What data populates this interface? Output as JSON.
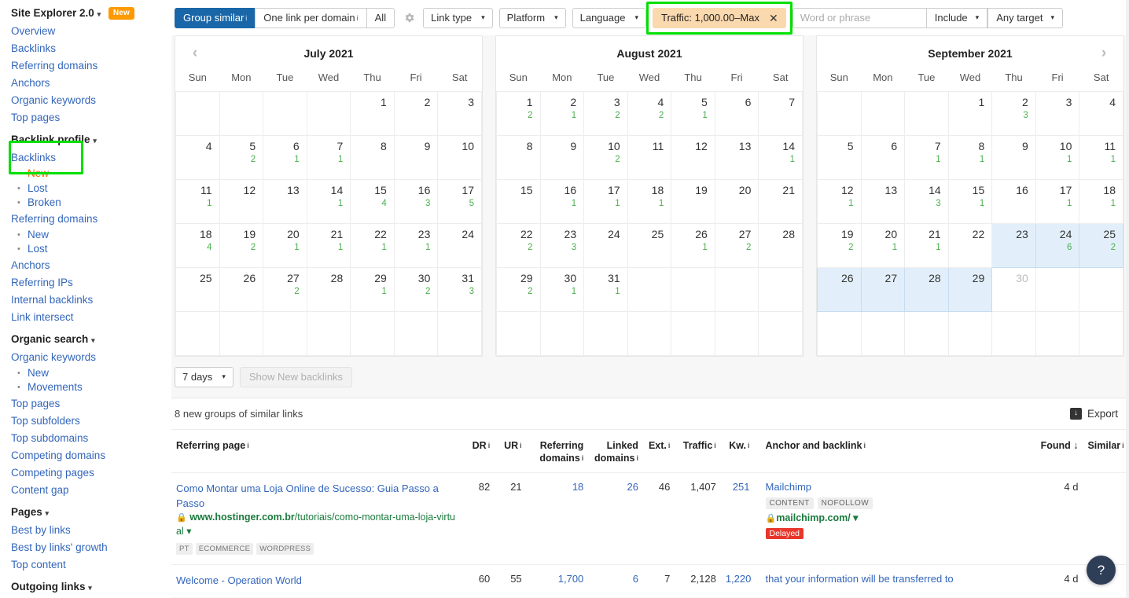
{
  "sidebar": {
    "header": {
      "title": "Site Explorer 2.0",
      "caret": "▾",
      "badge": "New"
    },
    "top_links": [
      "Overview",
      "Backlinks",
      "Referring domains",
      "Anchors",
      "Organic keywords",
      "Top pages"
    ],
    "groups": [
      {
        "title": "Backlink profile",
        "caret": "▾",
        "items": [
          {
            "label": "Backlinks",
            "type": "link"
          },
          {
            "label": "New",
            "type": "sub",
            "active": true
          },
          {
            "label": "Lost",
            "type": "sub"
          },
          {
            "label": "Broken",
            "type": "sub"
          },
          {
            "label": "Referring domains",
            "type": "link"
          },
          {
            "label": "New",
            "type": "sub"
          },
          {
            "label": "Lost",
            "type": "sub"
          },
          {
            "label": "Anchors",
            "type": "link"
          },
          {
            "label": "Referring IPs",
            "type": "link"
          },
          {
            "label": "Internal backlinks",
            "type": "link"
          },
          {
            "label": "Link intersect",
            "type": "link"
          }
        ]
      },
      {
        "title": "Organic search",
        "caret": "▾",
        "items": [
          {
            "label": "Organic keywords",
            "type": "link"
          },
          {
            "label": "New",
            "type": "sub"
          },
          {
            "label": "Movements",
            "type": "sub"
          },
          {
            "label": "Top pages",
            "type": "link"
          },
          {
            "label": "Top subfolders",
            "type": "link"
          },
          {
            "label": "Top subdomains",
            "type": "link"
          },
          {
            "label": "Competing domains",
            "type": "link"
          },
          {
            "label": "Competing pages",
            "type": "link"
          },
          {
            "label": "Content gap",
            "type": "link"
          }
        ]
      },
      {
        "title": "Pages",
        "caret": "▾",
        "items": [
          {
            "label": "Best by links",
            "type": "link"
          },
          {
            "label": "Best by links' growth",
            "type": "link"
          },
          {
            "label": "Top content",
            "type": "link"
          }
        ]
      },
      {
        "title": "Outgoing links",
        "caret": "▾",
        "items": []
      }
    ]
  },
  "toolbar": {
    "group_similar": "Group similar",
    "one_link_per_domain": "One link per domain",
    "all": "All",
    "gear_icon": "gear-icon",
    "link_type": "Link type",
    "platform": "Platform",
    "language": "Language",
    "traffic_filter": "Traffic: 1,000.00–Max",
    "traffic_filter_clear": "✕",
    "search_placeholder": "Word or phrase",
    "search_value": "",
    "include": "Include",
    "any_target": "Any target",
    "caret": "▾"
  },
  "calendars": {
    "weekdays": [
      "Sun",
      "Mon",
      "Tue",
      "Wed",
      "Thu",
      "Fri",
      "Sat"
    ],
    "prev_icon": "‹",
    "next_icon": "›",
    "months": [
      {
        "title": "July 2021",
        "weeks": [
          [
            {},
            {},
            {},
            {},
            {
              "d": "1"
            },
            {
              "d": "2"
            },
            {
              "d": "3"
            }
          ],
          [
            {
              "d": "4"
            },
            {
              "d": "5",
              "c": "2"
            },
            {
              "d": "6",
              "c": "1"
            },
            {
              "d": "7",
              "c": "1"
            },
            {
              "d": "8"
            },
            {
              "d": "9"
            },
            {
              "d": "10"
            }
          ],
          [
            {
              "d": "11",
              "c": "1"
            },
            {
              "d": "12"
            },
            {
              "d": "13"
            },
            {
              "d": "14",
              "c": "1"
            },
            {
              "d": "15",
              "c": "4"
            },
            {
              "d": "16",
              "c": "3"
            },
            {
              "d": "17",
              "c": "5"
            }
          ],
          [
            {
              "d": "18",
              "c": "4"
            },
            {
              "d": "19",
              "c": "2"
            },
            {
              "d": "20",
              "c": "1"
            },
            {
              "d": "21",
              "c": "1"
            },
            {
              "d": "22",
              "c": "1"
            },
            {
              "d": "23",
              "c": "1"
            },
            {
              "d": "24"
            }
          ],
          [
            {
              "d": "25"
            },
            {
              "d": "26"
            },
            {
              "d": "27",
              "c": "2"
            },
            {
              "d": "28"
            },
            {
              "d": "29",
              "c": "1"
            },
            {
              "d": "30",
              "c": "2"
            },
            {
              "d": "31",
              "c": "3"
            }
          ],
          [
            {},
            {},
            {},
            {},
            {},
            {},
            {}
          ]
        ]
      },
      {
        "title": "August 2021",
        "weeks": [
          [
            {
              "d": "1",
              "c": "2"
            },
            {
              "d": "2",
              "c": "1"
            },
            {
              "d": "3",
              "c": "2"
            },
            {
              "d": "4",
              "c": "2"
            },
            {
              "d": "5",
              "c": "1"
            },
            {
              "d": "6"
            },
            {
              "d": "7"
            }
          ],
          [
            {
              "d": "8"
            },
            {
              "d": "9"
            },
            {
              "d": "10",
              "c": "2"
            },
            {
              "d": "11"
            },
            {
              "d": "12"
            },
            {
              "d": "13"
            },
            {
              "d": "14",
              "c": "1"
            }
          ],
          [
            {
              "d": "15"
            },
            {
              "d": "16",
              "c": "1"
            },
            {
              "d": "17",
              "c": "1"
            },
            {
              "d": "18",
              "c": "1"
            },
            {
              "d": "19"
            },
            {
              "d": "20"
            },
            {
              "d": "21"
            }
          ],
          [
            {
              "d": "22",
              "c": "2"
            },
            {
              "d": "23",
              "c": "3"
            },
            {
              "d": "24"
            },
            {
              "d": "25"
            },
            {
              "d": "26",
              "c": "1"
            },
            {
              "d": "27",
              "c": "2"
            },
            {
              "d": "28"
            }
          ],
          [
            {
              "d": "29",
              "c": "2"
            },
            {
              "d": "30",
              "c": "1"
            },
            {
              "d": "31",
              "c": "1"
            },
            {},
            {},
            {},
            {}
          ],
          [
            {},
            {},
            {},
            {},
            {},
            {},
            {}
          ]
        ]
      },
      {
        "title": "September 2021",
        "weeks": [
          [
            {},
            {},
            {},
            {
              "d": "1"
            },
            {
              "d": "2",
              "c": "3"
            },
            {
              "d": "3"
            },
            {
              "d": "4"
            }
          ],
          [
            {
              "d": "5"
            },
            {
              "d": "6"
            },
            {
              "d": "7",
              "c": "1"
            },
            {
              "d": "8",
              "c": "1"
            },
            {
              "d": "9"
            },
            {
              "d": "10",
              "c": "1"
            },
            {
              "d": "11",
              "c": "1"
            }
          ],
          [
            {
              "d": "12",
              "c": "1"
            },
            {
              "d": "13"
            },
            {
              "d": "14",
              "c": "3"
            },
            {
              "d": "15",
              "c": "1"
            },
            {
              "d": "16"
            },
            {
              "d": "17",
              "c": "1"
            },
            {
              "d": "18",
              "c": "1"
            }
          ],
          [
            {
              "d": "19",
              "c": "2"
            },
            {
              "d": "20",
              "c": "1"
            },
            {
              "d": "21",
              "c": "1"
            },
            {
              "d": "22"
            },
            {
              "d": "23",
              "sel": true
            },
            {
              "d": "24",
              "c": "6",
              "sel": true
            },
            {
              "d": "25",
              "c": "2",
              "sel": true
            }
          ],
          [
            {
              "d": "26",
              "sel": true
            },
            {
              "d": "27",
              "sel": true
            },
            {
              "d": "28",
              "sel": true
            },
            {
              "d": "29",
              "sel": true
            },
            {
              "d": "30",
              "muted": true
            },
            {},
            {}
          ],
          [
            {},
            {},
            {},
            {},
            {},
            {},
            {}
          ]
        ]
      }
    ]
  },
  "controls": {
    "range_select": "7 days",
    "range_caret": "▾",
    "show_button": "Show New backlinks"
  },
  "results": {
    "count_label": "8 new groups of similar links",
    "export_label": "Export",
    "export_icon": "download-icon",
    "columns": [
      {
        "label": "Referring page",
        "info": "i",
        "align": "left"
      },
      {
        "label": "DR",
        "info": "i",
        "align": "right"
      },
      {
        "label": "UR",
        "info": "i",
        "align": "right"
      },
      {
        "label": "Referring domains",
        "info": "i",
        "align": "right"
      },
      {
        "label": "Linked domains",
        "info": "i",
        "align": "right"
      },
      {
        "label": "Ext.",
        "info": "i",
        "align": "right"
      },
      {
        "label": "Traffic",
        "info": "i",
        "align": "right"
      },
      {
        "label": "Kw.",
        "info": "i",
        "align": "right"
      },
      {
        "label": "Anchor and backlink",
        "info": "i",
        "align": "left"
      },
      {
        "label": "Found ↓",
        "info": "",
        "align": "right"
      },
      {
        "label": "Similar",
        "info": "i",
        "align": "right"
      }
    ],
    "rows": [
      {
        "title": "Como Montar uma Loja Online de Sucesso: Guia Passo a Passo",
        "url_bold": "www.hostinger.com.br",
        "url_rest": "/tutoriais/como-montar-uma-loja-virtual",
        "url_caret": "▾",
        "tags": [
          "PT",
          "ECOMMERCE",
          "WORDPRESS"
        ],
        "dr": "82",
        "ur": "21",
        "ref_domains": "18",
        "linked_domains": "26",
        "ext": "46",
        "traffic": "1,407",
        "kw": "251",
        "anchor": "Mailchimp",
        "anchor_tags": [
          "CONTENT",
          "NOFOLLOW"
        ],
        "backlink_url": "mailchimp.com/",
        "backlink_caret": "▾",
        "status_badge": "Delayed",
        "found": "4 d",
        "similar": ""
      },
      {
        "title": "Welcome - Operation World",
        "url_bold": "",
        "url_rest": "",
        "url_caret": "",
        "tags": [],
        "dr": "60",
        "ur": "55",
        "ref_domains": "1,700",
        "linked_domains": "6",
        "ext": "7",
        "traffic": "2,128",
        "kw": "1,220",
        "anchor": "that your information will be transferred to",
        "anchor_tags": [],
        "backlink_url": "",
        "backlink_caret": "",
        "status_badge": "",
        "found": "4 d",
        "similar": ""
      }
    ]
  },
  "help": {
    "icon": "question-mark-icon",
    "label": "?"
  },
  "colors": {
    "accent_blue": "#1967a8",
    "link_blue": "#3366bb",
    "count_green": "#4caf50",
    "url_green": "#1a7a3c",
    "highlight_green": "#00e000",
    "filter_orange": "#fbd9ae",
    "badge_orange": "#ff9900",
    "delayed_red": "#e8362b",
    "selected_day": "#e2effa"
  }
}
